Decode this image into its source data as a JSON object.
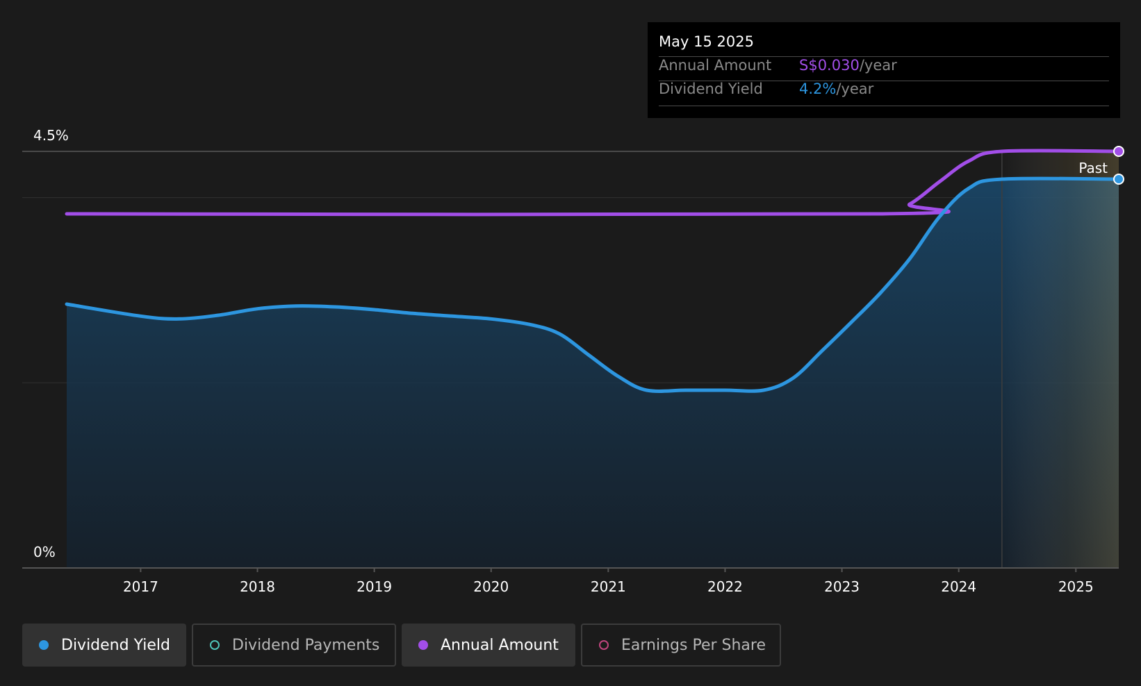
{
  "chart_data": {
    "type": "area",
    "y_tick_labels": [
      "4.5%",
      "0%"
    ],
    "ylim": [
      0,
      4.5
    ],
    "x_tick_labels": [
      "2017",
      "2018",
      "2019",
      "2020",
      "2021",
      "2022",
      "2023",
      "2024",
      "2025"
    ],
    "xlim": [
      "2016-05-15",
      "2025-05-15"
    ],
    "past_label": "Past",
    "forecast_start": "2024-05-15",
    "grid": true,
    "legend_placement": "bottom",
    "series": [
      {
        "name": "Dividend Yield",
        "unit": "%",
        "color": "#2d96e0",
        "filled": true,
        "points": [
          [
            "2016-05-15",
            2.85
          ],
          [
            "2017-01-01",
            2.72
          ],
          [
            "2017-05-01",
            2.69
          ],
          [
            "2017-09-01",
            2.73
          ],
          [
            "2018-01-01",
            2.8
          ],
          [
            "2018-05-01",
            2.83
          ],
          [
            "2018-09-01",
            2.82
          ],
          [
            "2019-01-01",
            2.79
          ],
          [
            "2019-05-01",
            2.75
          ],
          [
            "2019-09-01",
            2.72
          ],
          [
            "2020-01-01",
            2.69
          ],
          [
            "2020-05-01",
            2.63
          ],
          [
            "2020-08-01",
            2.53
          ],
          [
            "2020-11-01",
            2.3
          ],
          [
            "2021-02-01",
            2.07
          ],
          [
            "2021-05-01",
            1.92
          ],
          [
            "2021-09-01",
            1.92
          ],
          [
            "2022-01-01",
            1.92
          ],
          [
            "2022-05-01",
            1.92
          ],
          [
            "2022-08-01",
            2.05
          ],
          [
            "2022-11-01",
            2.35
          ],
          [
            "2023-02-01",
            2.66
          ],
          [
            "2023-05-01",
            2.97
          ],
          [
            "2023-08-01",
            3.34
          ],
          [
            "2023-11-01",
            3.79
          ],
          [
            "2024-02-01",
            4.1
          ],
          [
            "2024-05-15",
            4.2
          ],
          [
            "2025-05-15",
            4.2
          ]
        ]
      },
      {
        "name": "Annual Amount",
        "unit": "S$/year",
        "color": "#a24ee8",
        "filled": false,
        "points": [
          [
            "2016-05-15",
            0.0255
          ],
          [
            "2023-05-01",
            0.0255
          ],
          [
            "2023-08-01",
            0.0262
          ],
          [
            "2023-11-01",
            0.0278
          ],
          [
            "2024-02-01",
            0.0293
          ],
          [
            "2024-05-15",
            0.03
          ],
          [
            "2025-05-15",
            0.03
          ]
        ]
      }
    ]
  },
  "tooltip": {
    "date": "May 15 2025",
    "rows": [
      {
        "label": "Annual Amount",
        "value": "S$0.030",
        "unit": "/year",
        "color": "#a24ee8"
      },
      {
        "label": "Dividend Yield",
        "value": "4.2%",
        "unit": "/year",
        "color": "#2d96e0"
      }
    ]
  },
  "legend": [
    {
      "label": "Dividend Yield",
      "active": true,
      "color": "#2d96e0"
    },
    {
      "label": "Dividend Payments",
      "active": false,
      "color": "#4fc3b8"
    },
    {
      "label": "Annual Amount",
      "active": true,
      "color": "#a24ee8"
    },
    {
      "label": "Earnings Per Share",
      "active": false,
      "color": "#c0457e"
    }
  ]
}
